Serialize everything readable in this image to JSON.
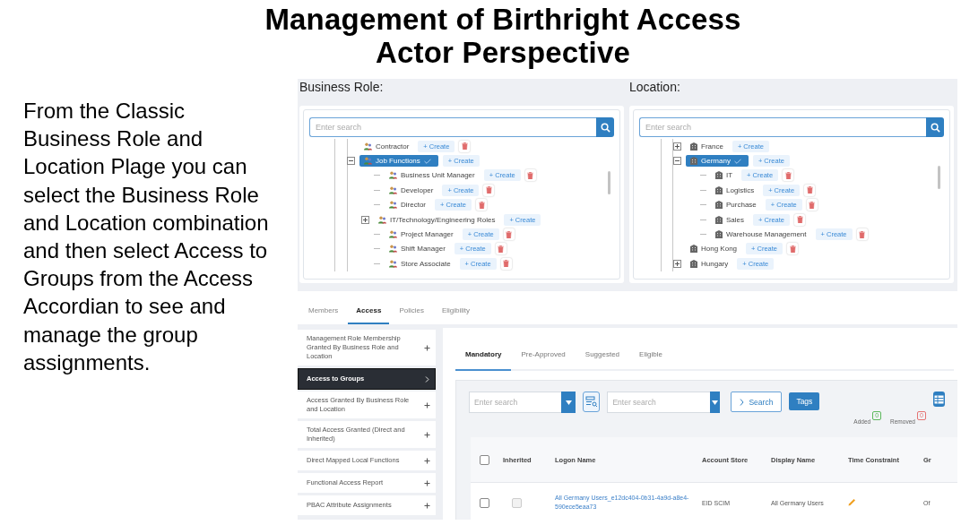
{
  "title": [
    "Management of Birthright Access",
    "Actor Perspective"
  ],
  "description": "From the Classic Business Role and Location Plage you can select the Business Role and Location combination and then select Access to Groups from the Access Accordian to see and manage the group assignments.",
  "pickers": [
    {
      "label": "Business Role:",
      "kind": "role",
      "search": {
        "placeholder": "Enter search"
      },
      "nodes": [
        {
          "label": "Contractor",
          "create": "+ Create",
          "deletable": true,
          "selected": false
        },
        {
          "label": "Job Functions",
          "create": "+ Create",
          "deletable": false,
          "selected": true,
          "expanded": true,
          "children": [
            {
              "label": "Business Unit Manager",
              "create": "+ Create",
              "deletable": true,
              "selected": false
            },
            {
              "label": "Developer",
              "create": "+ Create",
              "deletable": true,
              "selected": false
            },
            {
              "label": "Director",
              "create": "+ Create",
              "deletable": true,
              "selected": false
            },
            {
              "label": "IT/Technology/Engineering Roles",
              "create": "+ Create",
              "deletable": false,
              "selected": false,
              "expanded": false
            },
            {
              "label": "Project Manager",
              "create": "+ Create",
              "deletable": true,
              "selected": false
            },
            {
              "label": "Shift Manager",
              "create": "+ Create",
              "deletable": true,
              "selected": false
            },
            {
              "label": "Store Associate",
              "create": "+ Create",
              "deletable": true,
              "selected": false
            }
          ]
        }
      ]
    },
    {
      "label": "Location:",
      "kind": "location",
      "search": {
        "placeholder": "Enter search"
      },
      "nodes": [
        {
          "label": "France",
          "create": "+ Create",
          "deletable": false,
          "selected": false,
          "expanded": false
        },
        {
          "label": "Germany",
          "create": "+ Create",
          "deletable": false,
          "selected": true,
          "expanded": true,
          "children": [
            {
              "label": "IT",
              "create": "+ Create",
              "deletable": true,
              "selected": false
            },
            {
              "label": "Logistics",
              "create": "+ Create",
              "deletable": true,
              "selected": false
            },
            {
              "label": "Purchase",
              "create": "+ Create",
              "deletable": true,
              "selected": false
            },
            {
              "label": "Sales",
              "create": "+ Create",
              "deletable": true,
              "selected": false
            },
            {
              "label": "Warehouse Management",
              "create": "+ Create",
              "deletable": true,
              "selected": false
            }
          ]
        },
        {
          "label": "Hong Kong",
          "create": "+ Create",
          "deletable": true,
          "selected": false
        },
        {
          "label": "Hungary",
          "create": "+ Create",
          "deletable": false,
          "selected": false,
          "expanded": false
        }
      ]
    }
  ],
  "tabs": [
    {
      "label": "Members",
      "selected": false
    },
    {
      "label": "Access",
      "selected": true
    },
    {
      "label": "Policies",
      "selected": false
    },
    {
      "label": "Eligibility",
      "selected": false
    }
  ],
  "accordion": [
    {
      "label": "Management Role Membership Granted By Business Role and Location",
      "selected": false
    },
    {
      "label": "Access to Groups",
      "selected": true
    },
    {
      "label": "Access Granted By Business Role and Location",
      "selected": false
    },
    {
      "label": "Total Access Granted (Direct and Inherited)",
      "selected": false
    },
    {
      "label": "Direct Mapped Local Functions",
      "selected": false
    },
    {
      "label": "Functional Access Report",
      "selected": false
    },
    {
      "label": "PBAC Attribute Assignments",
      "selected": false
    }
  ],
  "subtabs": [
    {
      "label": "Mandatory",
      "selected": true
    },
    {
      "label": "Pre-Approved",
      "selected": false
    },
    {
      "label": "Suggested",
      "selected": false
    },
    {
      "label": "Eligible",
      "selected": false
    }
  ],
  "filters": {
    "search_1": {
      "placeholder": "Enter search"
    },
    "search_2": {
      "placeholder": "Enter search"
    },
    "search_button": "Search",
    "tags_button": "Tags",
    "badges": [
      {
        "label": "Added",
        "count": "0",
        "color": "#5cb85c"
      },
      {
        "label": "Removed",
        "count": "0",
        "color": "#e57373"
      }
    ]
  },
  "table": {
    "header_checked": false,
    "columns": [
      "Inherited",
      "Logon Name",
      "Account Store",
      "Display Name",
      "Time Constraint",
      "Gr"
    ],
    "rows": [
      {
        "checked": false,
        "inherited": false,
        "logon_name": "All Germany Users_e12dc404-0b31-4a9d-a8e4-590ece5eaa73",
        "account_store": "EID SCIM",
        "display_name": "All Germany Users",
        "column_7": "Of"
      }
    ]
  }
}
